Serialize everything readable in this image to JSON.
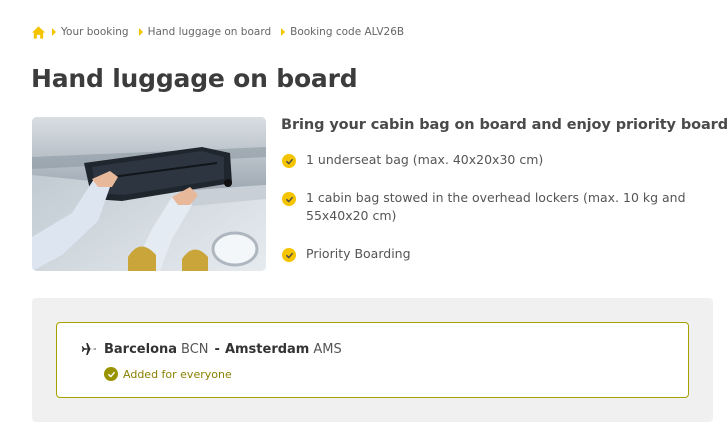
{
  "breadcrumb": {
    "items": [
      "Your booking",
      "Hand luggage on board",
      "Booking code ALV26B"
    ]
  },
  "page": {
    "title": "Hand luggage on board"
  },
  "features": {
    "heading": "Bring your cabin bag on board and enjoy priority boarding",
    "items": [
      "1 underseat bag (max. 40x20x30 cm)",
      "1 cabin bag stowed in the overhead lockers (max. 10 kg and 55x40x20 cm)",
      "Priority Boarding"
    ]
  },
  "flight": {
    "origin_city": "Barcelona",
    "origin_code": "BCN",
    "separator": "-",
    "destination_city": "Amsterdam",
    "destination_code": "AMS",
    "status": "Added for everyone"
  },
  "icons": {
    "home": "home-icon",
    "check": "check-icon",
    "plane": "plane-icon"
  },
  "colors": {
    "accent": "#f5c400",
    "olive": "#9a9300",
    "panel": "#f0f0f0"
  }
}
